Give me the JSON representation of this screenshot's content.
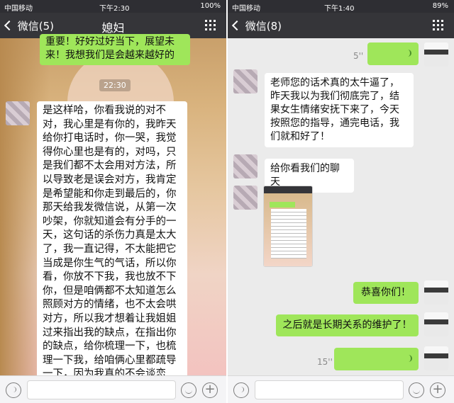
{
  "left": {
    "status": {
      "carrier": "中国移动",
      "time": "下午2:30",
      "battery": "100%"
    },
    "nav": {
      "back_label": "微信(5)",
      "title": "媳妇"
    },
    "messages": {
      "top_green": "重要！好好过好当下，展望未来！我想我们是会越来越好的",
      "time_chip": "22:30",
      "long_white": "是这样哈，你看我说的对不对，我心里是有你的，我昨天给你打电话时，你一哭，我觉得你心里也是有的，对吗，只是我们都不太会用对方法，所以导致老是误会对方，我肯定是希望能和你走到最后的，你那天给我发微信说，从第一次吵架，你就知道会有分手的一天，这句话的杀伤力真是太大了，我一直记得，不太能把它当成是你生气的气话，所以你看，你放不下我，我也放不下你，但是咱俩都不太知道怎么照顾对方的情绪，也不太会哄对方，所以我才想着让我姐姐过来指出我的缺点，在指出你的缺点，给你梳理一下，也梳理一下我，给咱俩心里都疏导一下，因为我真的不会谈恋爱，不会与人相处，你也是一样，所以今天才和你说这个，"
    }
  },
  "right": {
    "status": {
      "carrier": "中国移动",
      "time": "下午1:40",
      "battery": "89%"
    },
    "nav": {
      "back_label": "微信(8)"
    },
    "messages": {
      "voice1_duration": "5''",
      "white1": "老师您的话术真的太牛逼了，昨天我以为我们彻底完了，结果女生情绪安抚下来了，今天按照您的指导，通完电话，我们就和好了！",
      "white2": "给你看我们的聊天",
      "green1": "恭喜你们！",
      "green2": "之后就是长期关系的维护了！",
      "voice2_duration": "15''"
    }
  },
  "icons": {
    "back": "chevron-left-icon",
    "more": "grid-more-icon",
    "voice": "voice-icon",
    "emoji": "emoji-icon",
    "plus": "plus-icon"
  },
  "colors": {
    "green_bubble": "#9fe65a",
    "nav_bg": "#353539"
  }
}
